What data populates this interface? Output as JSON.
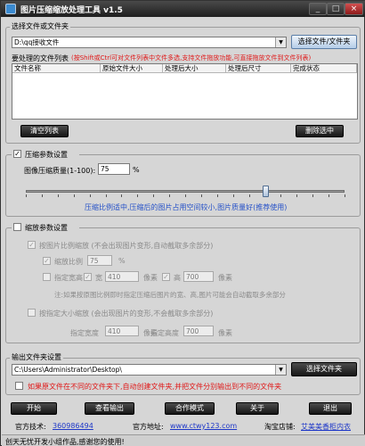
{
  "app": {
    "title": "图片压缩缩放处理工具 v1.5"
  },
  "window_controls": {
    "minimize": "_",
    "maximize": "□",
    "close": "×"
  },
  "source": {
    "group_title": "选择文件或文件夹",
    "path": "D:\\qq接收文件",
    "select_button": "选择文件/文件夹"
  },
  "file_list": {
    "label": "要处理的文件列表",
    "hint": "(按Shift或Ctrl可对文件列表中文件多选,支持文件拖放功能,可直接拖放文件到文件列表)",
    "columns": [
      "文件名称",
      "原始文件大小",
      "处理后大小",
      "处理后尺寸",
      "完成状态"
    ],
    "clear_button": "清空列表",
    "delete_button": "删除选中"
  },
  "compression": {
    "checked": true,
    "checkbox_label": "压缩参数设置",
    "quality_label": "图像压缩质量(1-100):",
    "quality_value": "75",
    "quality_unit": "%",
    "slider_level": 0.75,
    "hint": "压缩比例适中,压缩后的图片占用空间较小,图片质量好(推荐使用)"
  },
  "scaling": {
    "checked": false,
    "checkbox_label": "缩放参数设置",
    "by_ratio_label": "按图片比例缩放 (不会出现图片变形,自动截取多余部分)",
    "ratio_label": "缩放比例",
    "ratio_value": "75",
    "ratio_unit": "%",
    "specify_label": "指定宽高",
    "width_label": "宽",
    "width_value": "410",
    "height_label": "高",
    "height_value": "700",
    "pixel_unit": "像素",
    "note": "注:如果按原图比例即时指定压缩后图片的宽、高,图片可能会自动截取多余部分",
    "by_size_label": "按指定大小缩放 (会出现图片的变形,不会截取多余部分)",
    "fixed_width_label": "指定宽度",
    "fixed_width_value": "410",
    "fixed_height_label": "指定高度",
    "fixed_height_value": "700"
  },
  "output": {
    "group_title": "输出文件夹设置",
    "path": "C:\\Users\\Administrator\\Desktop\\",
    "select_button": "选择文件夹",
    "auto_create_label": "如果原文件在不同的文件夹下,自动创建文件夹,并把文件分别输出到不同的文件夹",
    "auto_create_checked": false
  },
  "actions": {
    "start": "开始",
    "view_output": "查看输出",
    "cooperation": "合作模式",
    "about": "关于",
    "exit": "退出"
  },
  "footer": {
    "qq_label": "官方技术:",
    "qq_value": "360986494",
    "site_label": "官方地址:",
    "site_value": "www.ctwy123.com",
    "shop_label": "淘宝店铺:",
    "shop_value": "艾美美香柜内衣"
  },
  "status": {
    "text": "创天无忧开发小组作品,感谢您的使用!"
  }
}
